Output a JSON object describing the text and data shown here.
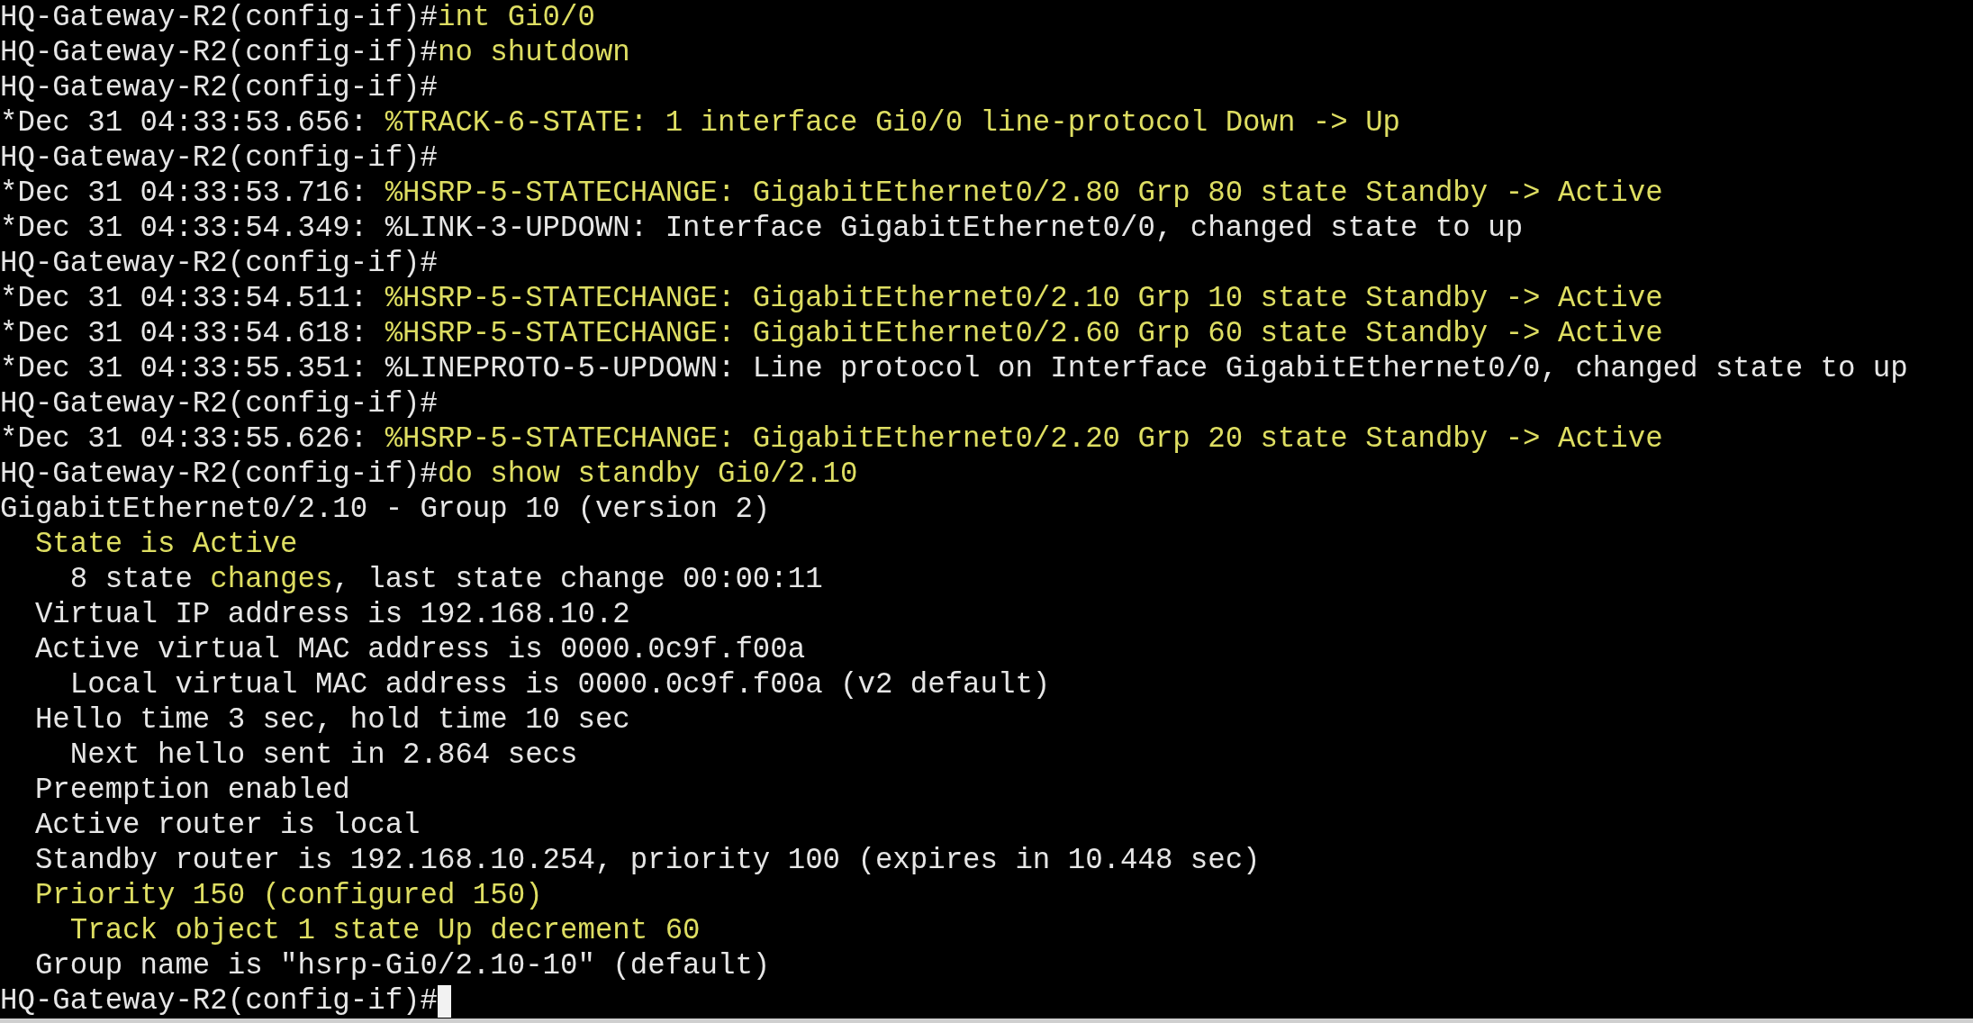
{
  "terminal": {
    "cursor_visible": true,
    "lines": [
      {
        "segments": [
          {
            "text": "HQ-Gateway-R2(config-if)#",
            "kind": "plain"
          },
          {
            "text": "int Gi0/0",
            "kind": "highlight"
          }
        ]
      },
      {
        "segments": [
          {
            "text": "HQ-Gateway-R2(config-if)#",
            "kind": "plain"
          },
          {
            "text": "no shutdown",
            "kind": "highlight"
          }
        ]
      },
      {
        "segments": [
          {
            "text": "HQ-Gateway-R2(config-if)#",
            "kind": "plain"
          }
        ]
      },
      {
        "segments": [
          {
            "text": "*Dec 31 04:33:53.656: ",
            "kind": "plain"
          },
          {
            "text": "%TRACK-6-STATE: 1 interface Gi0/0 line-protocol Down -> Up",
            "kind": "highlight"
          }
        ]
      },
      {
        "segments": [
          {
            "text": "HQ-Gateway-R2(config-if)#",
            "kind": "plain"
          }
        ]
      },
      {
        "segments": [
          {
            "text": "*Dec 31 04:33:53.716: ",
            "kind": "plain"
          },
          {
            "text": "%HSRP-5-STATECHANGE: GigabitEthernet0/2.80 Grp 80 state Standby -> Active",
            "kind": "highlight"
          }
        ]
      },
      {
        "segments": [
          {
            "text": "*Dec 31 04:33:54.349: %LINK-3-UPDOWN: Interface GigabitEthernet0/0, changed state to up",
            "kind": "plain"
          }
        ]
      },
      {
        "segments": [
          {
            "text": "HQ-Gateway-R2(config-if)#",
            "kind": "plain"
          }
        ]
      },
      {
        "segments": [
          {
            "text": "*Dec 31 04:33:54.511: ",
            "kind": "plain"
          },
          {
            "text": "%HSRP-5-STATECHANGE: GigabitEthernet0/2.10 Grp 10 state Standby -> Active",
            "kind": "highlight"
          }
        ]
      },
      {
        "segments": [
          {
            "text": "*Dec 31 04:33:54.618: ",
            "kind": "plain"
          },
          {
            "text": "%HSRP-5-STATECHANGE: GigabitEthernet0/2.60 Grp 60 state Standby -> Active",
            "kind": "highlight"
          }
        ]
      },
      {
        "segments": [
          {
            "text": "*Dec 31 04:33:55.351: %LINEPROTO-5-UPDOWN: Line protocol on Interface GigabitEthernet0/0, changed state to up",
            "kind": "plain"
          }
        ]
      },
      {
        "segments": [
          {
            "text": "HQ-Gateway-R2(config-if)#",
            "kind": "plain"
          }
        ]
      },
      {
        "segments": [
          {
            "text": "*Dec 31 04:33:55.626: ",
            "kind": "plain"
          },
          {
            "text": "%HSRP-5-STATECHANGE: GigabitEthernet0/2.20 Grp 20 state Standby -> Active",
            "kind": "highlight"
          }
        ]
      },
      {
        "segments": [
          {
            "text": "HQ-Gateway-R2(config-if)#",
            "kind": "plain"
          },
          {
            "text": "do show standby Gi0/2.10",
            "kind": "highlight"
          }
        ]
      },
      {
        "segments": [
          {
            "text": "GigabitEthernet0/2.10 - Group 10 (version 2)",
            "kind": "plain"
          }
        ]
      },
      {
        "segments": [
          {
            "text": "  State is Active",
            "kind": "highlight"
          }
        ]
      },
      {
        "segments": [
          {
            "text": "    8 state ",
            "kind": "plain"
          },
          {
            "text": "changes",
            "kind": "highlight"
          },
          {
            "text": ", last state change 00:00:11",
            "kind": "plain"
          }
        ]
      },
      {
        "segments": [
          {
            "text": "  Virtual IP address is 192.168.10.2",
            "kind": "plain"
          }
        ]
      },
      {
        "segments": [
          {
            "text": "  Active virtual MAC address is 0000.0c9f.f00a",
            "kind": "plain"
          }
        ]
      },
      {
        "segments": [
          {
            "text": "    Local virtual MAC address is 0000.0c9f.f00a (v2 default)",
            "kind": "plain"
          }
        ]
      },
      {
        "segments": [
          {
            "text": "  Hello time 3 sec, hold time 10 sec",
            "kind": "plain"
          }
        ]
      },
      {
        "segments": [
          {
            "text": "    Next hello sent in 2.864 secs",
            "kind": "plain"
          }
        ]
      },
      {
        "segments": [
          {
            "text": "  Preemption enabled",
            "kind": "plain"
          }
        ]
      },
      {
        "segments": [
          {
            "text": "  Active router is local",
            "kind": "plain"
          }
        ]
      },
      {
        "segments": [
          {
            "text": "  Standby router is 192.168.10.254, priority 100 (expires in 10.448 sec)",
            "kind": "plain"
          }
        ]
      },
      {
        "segments": [
          {
            "text": "  Priority 150 (configured 150)",
            "kind": "highlight"
          }
        ]
      },
      {
        "segments": [
          {
            "text": "    Track object 1 state Up decrement 60",
            "kind": "highlight"
          }
        ]
      },
      {
        "segments": [
          {
            "text": "  Group name is \"hsrp-Gi0/2.10-10\" (default)",
            "kind": "plain"
          }
        ]
      },
      {
        "segments": [
          {
            "text": "HQ-Gateway-R2(config-if)#",
            "kind": "plain"
          }
        ]
      }
    ]
  }
}
